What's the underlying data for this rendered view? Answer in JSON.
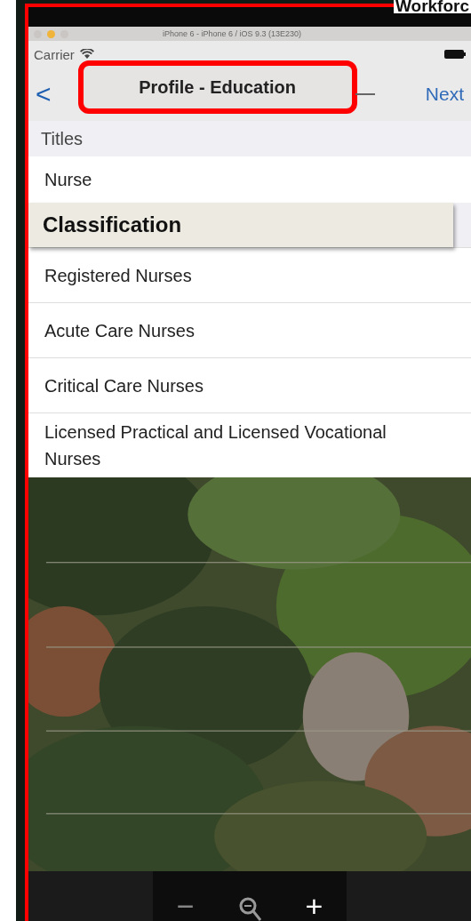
{
  "overlay_label": "Workforc",
  "simulator": {
    "title": "iPhone 6 - iPhone 6 / iOS 9.3 (13E230)"
  },
  "status_bar": {
    "carrier": "Carrier"
  },
  "nav_bar": {
    "back": "<",
    "title": "Profile - Education",
    "next": "Next"
  },
  "sections": [
    {
      "header": "Titles",
      "items": [
        "Nurse"
      ]
    },
    {
      "header": "Classification",
      "callout": true,
      "items": [
        "Registered Nurses",
        "Acute Care Nurses",
        "Critical Care Nurses",
        "Licensed Practical and Licensed Vocational Nurses"
      ]
    }
  ],
  "zoom_bar": {
    "minus": "−",
    "plus": "+"
  }
}
